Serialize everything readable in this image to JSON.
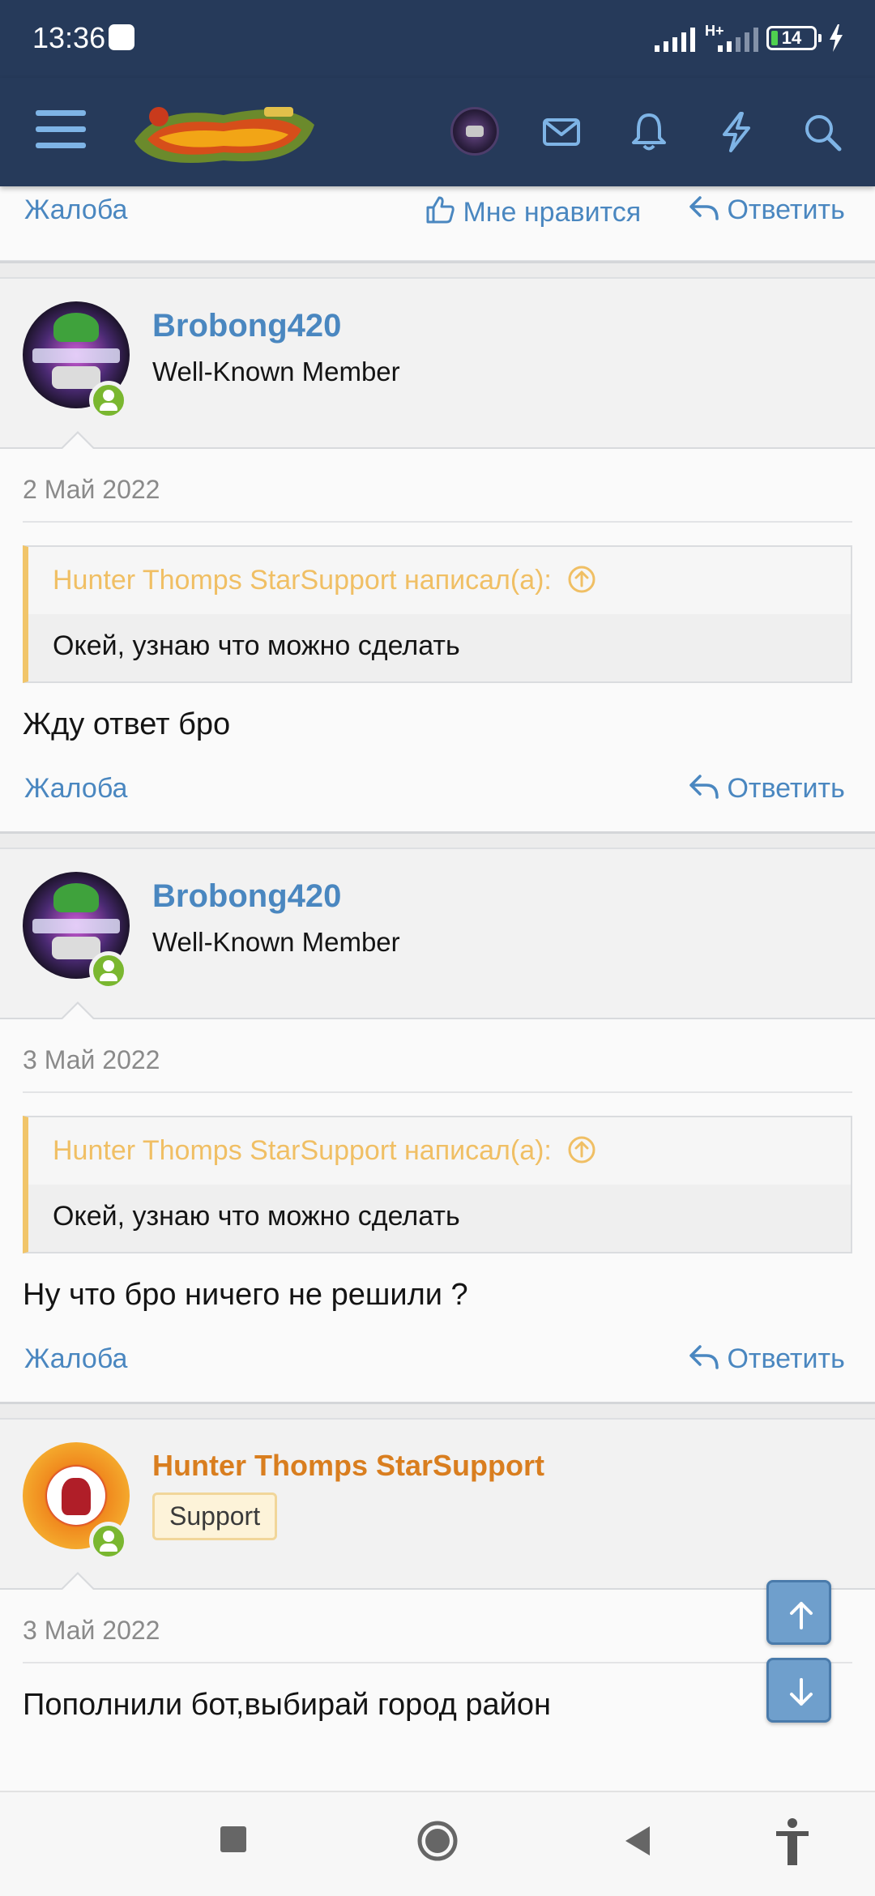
{
  "status_bar": {
    "time": "13:36",
    "network_label": "H+",
    "battery": "14"
  },
  "top_actions": {
    "report": "Жалоба",
    "like": "Мне нравится",
    "reply": "Ответить"
  },
  "posts": [
    {
      "username": "Brobong420",
      "user_title": "Well-Known Member",
      "date": "2 Май 2022",
      "quote_header": "Hunter Thomps StarSupport написал(а):",
      "quote_text": "Окей, узнаю что можно сделать",
      "message": "Жду ответ бро",
      "report": "Жалоба",
      "reply": "Ответить"
    },
    {
      "username": "Brobong420",
      "user_title": "Well-Known Member",
      "date": "3 Май 2022",
      "quote_header": "Hunter Thomps StarSupport написал(а):",
      "quote_text": "Окей, узнаю что можно сделать",
      "message": "Ну что бро ничего не решили ?",
      "report": "Жалоба",
      "reply": "Ответить"
    },
    {
      "username": "Hunter Thomps StarSupport",
      "badge": "Support",
      "date": "3 Май 2022",
      "message": "Пополнили бот,выбирай город район"
    }
  ],
  "icons": {
    "menu": "hamburger-icon",
    "mail": "envelope-icon",
    "alerts": "bell-icon",
    "whats_new": "lightning-icon",
    "search": "search-icon",
    "scroll_up": "arrow-up-icon",
    "scroll_down": "arrow-down-icon"
  },
  "colors": {
    "header_bg": "#263a5a",
    "link": "#4a87c0",
    "staff_name": "#d97e1f",
    "quote_accent": "#f1c56a",
    "online": "#7ab730"
  }
}
